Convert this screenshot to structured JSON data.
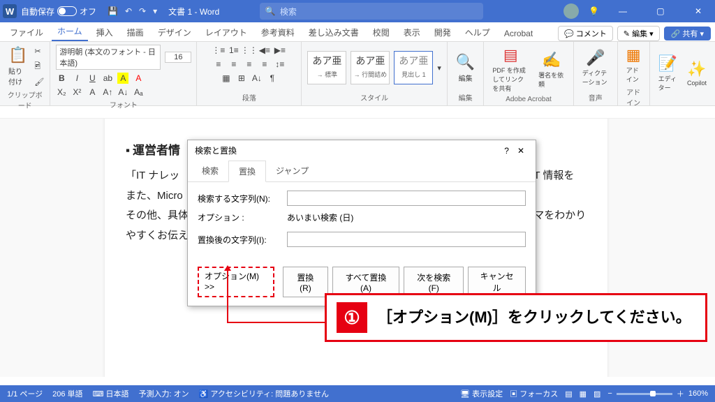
{
  "titlebar": {
    "autosave_label": "自動保存",
    "autosave_state": "オフ",
    "doc_title": "文書 1 - Word",
    "search_placeholder": "検索"
  },
  "tabs": {
    "items": [
      "ファイル",
      "ホーム",
      "挿入",
      "描画",
      "デザイン",
      "レイアウト",
      "参考資料",
      "差し込み文書",
      "校閲",
      "表示",
      "開発",
      "ヘルプ",
      "Acrobat"
    ],
    "active": 1,
    "comment": "コメント",
    "edit": "編集",
    "share": "共有"
  },
  "ribbon": {
    "clipboard": {
      "label": "クリップボード",
      "paste": "貼り付け"
    },
    "font": {
      "label": "フォント",
      "name": "游明朝 (本文のフォント - 日本語)",
      "size": "16"
    },
    "paragraph": {
      "label": "段落"
    },
    "styles": {
      "label": "スタイル",
      "items": [
        {
          "sample": "あア亜",
          "name": "→ 標準"
        },
        {
          "sample": "あア亜",
          "name": "→ 行間詰め"
        },
        {
          "sample": "あア亜",
          "name": "見出し 1"
        }
      ]
    },
    "editing": {
      "label": "編集",
      "text": "編集"
    },
    "acrobat": {
      "label": "Adobe Acrobat",
      "pdf": "PDF を作成してリンクを共有",
      "sig": "署名を依頼"
    },
    "voice": {
      "label": "音声",
      "dict": "ディクテーション"
    },
    "addin": {
      "label": "アドイン",
      "text": "アドイン"
    },
    "editor": {
      "text": "エディター"
    },
    "copilot": {
      "text": "Copilot"
    }
  },
  "document": {
    "heading": "運営者情",
    "p1": "「IT ナレッ",
    "p1b": "生活に役立つ IT 情報を",
    "p2": "また、Micro                                                                                   グ、PowerPoint                                                                              （マクロ）の活用方法",
    "p3": "その他、具体的なトラブル解決方法や便利なフリーソフトの活用方法など、幅広いテーマをわかりやすくお伝えしています。"
  },
  "dialog": {
    "title": "検索と置換",
    "tabs": [
      "検索",
      "置換",
      "ジャンプ"
    ],
    "active": 1,
    "find_label": "検索する文字列(N):",
    "options_label": "オプション :",
    "options_value": "あいまい検索 (日)",
    "replace_label": "置換後の文字列(I):",
    "more": "オプション(M) >>",
    "btn_replace": "置換(R)",
    "btn_replace_all": "すべて置換(A)",
    "btn_find_next": "次を検索(F)",
    "btn_cancel": "キャンセル"
  },
  "callout": {
    "num": "①",
    "text": "［オプション(M)］をクリックしてください。"
  },
  "statusbar": {
    "page": "1/1 ページ",
    "words": "206 単語",
    "lang": "日本語",
    "predict": "予測入力: オン",
    "a11y": "アクセシビリティ: 問題ありません",
    "display": "表示設定",
    "focus": "フォーカス",
    "zoom": "160%"
  }
}
